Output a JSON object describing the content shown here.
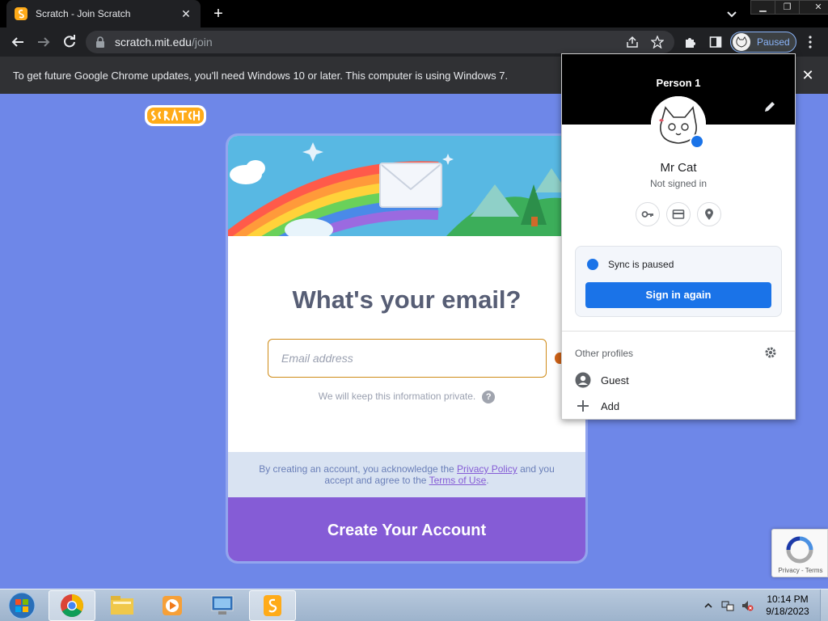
{
  "browser": {
    "tab_title": "Scratch - Join Scratch",
    "url_host": "scratch.mit.edu",
    "url_path": "/join",
    "profile_chip_label": "Paused"
  },
  "infobar": {
    "message": "To get future Google Chrome updates, you'll need Windows 10 or later. This computer is using Windows 7."
  },
  "join_form": {
    "heading": "What's your email?",
    "email_placeholder": "Email address",
    "privacy_note": "We will keep this information private.",
    "help_glyph": "?",
    "terms_prefix": "By creating an account, you acknowledge the ",
    "privacy_link": "Privacy Policy",
    "terms_middle": " and you accept and agree to the ",
    "terms_link": "Terms of Use",
    "terms_suffix": ".",
    "create_button": "Create Your Account"
  },
  "recaptcha": {
    "footer": "Privacy - Terms"
  },
  "profile_menu": {
    "title": "Person 1",
    "user_name": "Mr Cat",
    "status": "Not signed in",
    "sync_text": "Sync is paused",
    "sign_in_button": "Sign in again",
    "other_profiles_label": "Other profiles",
    "items": [
      {
        "label": "Guest",
        "icon": "person-circle-icon"
      },
      {
        "label": "Add",
        "icon": "plus-icon"
      }
    ],
    "action_icons": [
      "key-icon",
      "credit-card-icon",
      "location-pin-icon"
    ]
  },
  "taskbar": {
    "time": "10:14 PM",
    "date": "9/18/2023",
    "apps": [
      "chrome-icon",
      "file-explorer-icon",
      "media-player-icon",
      "remote-desktop-icon",
      "scratch-app-icon"
    ]
  },
  "colors": {
    "page_bg": "#6e87e8",
    "scratch_purple": "#855cd6",
    "chrome_blue": "#1a73e8",
    "paused_blue": "#8ab4f8"
  }
}
